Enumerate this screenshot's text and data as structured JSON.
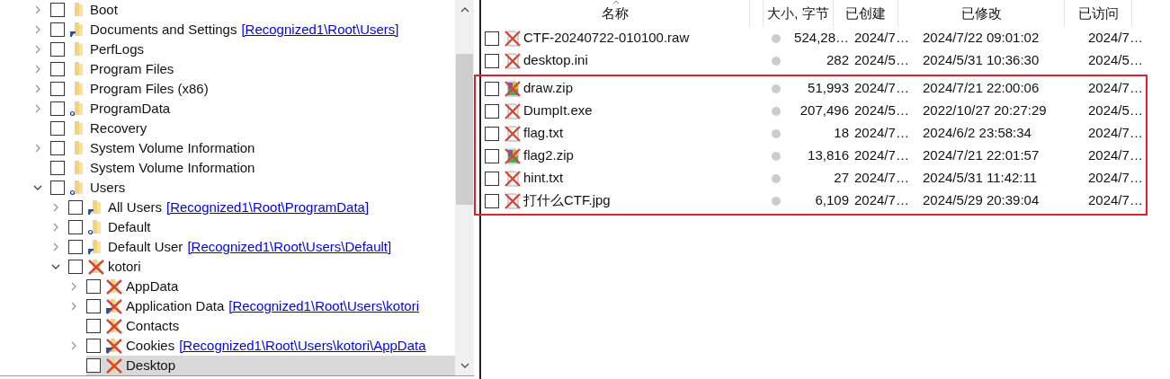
{
  "tree": [
    {
      "label": "Boot",
      "kind": "folder",
      "expanded": false,
      "checked": false,
      "selected": false
    },
    {
      "label": "Documents and Settings",
      "link": "[Recognized1\\Root\\Users]",
      "kind": "link",
      "expanded": false,
      "checked": false,
      "selected": false
    },
    {
      "label": "PerfLogs",
      "kind": "folder",
      "expanded": false,
      "checked": false,
      "selected": false
    },
    {
      "label": "Program Files",
      "kind": "folder",
      "expanded": false,
      "checked": false,
      "selected": false
    },
    {
      "label": "Program Files (x86)",
      "kind": "folder",
      "expanded": false,
      "checked": false,
      "selected": false
    },
    {
      "label": "ProgramData",
      "kind": "system",
      "expanded": false,
      "checked": false,
      "selected": false
    },
    {
      "label": "Recovery",
      "kind": "folder",
      "checked": false,
      "selected": false
    },
    {
      "label": "System Volume Information",
      "kind": "folder",
      "expanded": false,
      "checked": false,
      "selected": false
    },
    {
      "label": "System Volume Information",
      "kind": "folder",
      "checked": false,
      "selected": false
    },
    {
      "label": "Users",
      "kind": "system",
      "expanded": true,
      "checked": false,
      "selected": false,
      "children": [
        {
          "label": "All Users",
          "link": "[Recognized1\\Root\\ProgramData]",
          "kind": "link",
          "expanded": false,
          "checked": false,
          "selected": false
        },
        {
          "label": "Default",
          "kind": "system",
          "expanded": false,
          "checked": false,
          "selected": false
        },
        {
          "label": "Default User",
          "link": "[Recognized1\\Root\\Users\\Default]",
          "kind": "link",
          "expanded": false,
          "checked": false,
          "selected": false
        },
        {
          "label": "kotori",
          "kind": "deleted",
          "expanded": true,
          "checked": false,
          "selected": false,
          "children": [
            {
              "label": "AppData",
              "kind": "deleted",
              "expanded": false,
              "checked": false,
              "selected": false
            },
            {
              "label": "Application Data",
              "link": "[Recognized1\\Root\\Users\\kotori",
              "kind": "deleted-link",
              "expanded": false,
              "checked": false,
              "selected": false
            },
            {
              "label": "Contacts",
              "kind": "deleted",
              "checked": false,
              "selected": false
            },
            {
              "label": "Cookies",
              "link": "[Recognized1\\Root\\Users\\kotori\\AppData",
              "kind": "deleted-link",
              "expanded": false,
              "checked": false,
              "selected": false
            },
            {
              "label": "Desktop",
              "kind": "deleted",
              "checked": false,
              "selected": true
            }
          ]
        }
      ]
    }
  ],
  "table": {
    "columns": [
      "名称",
      "大小, 字节",
      "已创建",
      "已修改",
      "已访问"
    ],
    "rows": [
      {
        "name": "CTF-20240722-010100.raw",
        "kind": "file",
        "size": "524,28…",
        "created": "2024/7…",
        "modified": "2024/7/22 09:01:02",
        "accessed": "2024/7…",
        "checked": false
      },
      {
        "name": "desktop.ini",
        "kind": "file",
        "size": "282",
        "created": "2024/5…",
        "modified": "2024/5/31 10:36:30",
        "accessed": "2024/5…",
        "checked": false
      }
    ],
    "marked_rows": [
      {
        "name": "draw.zip",
        "kind": "archive",
        "size": "51,993",
        "created": "2024/7…",
        "modified": "2024/7/21 22:00:06",
        "accessed": "2024/7…",
        "checked": false
      },
      {
        "name": "DumpIt.exe",
        "kind": "file",
        "size": "207,496",
        "created": "2024/5…",
        "modified": "2022/10/27 20:27:29",
        "accessed": "2024/5…",
        "checked": false
      },
      {
        "name": "flag.txt",
        "kind": "file",
        "size": "18",
        "created": "2024/7…",
        "modified": "2024/6/2 23:58:34",
        "accessed": "2024/7…",
        "checked": false
      },
      {
        "name": "flag2.zip",
        "kind": "archive",
        "size": "13,816",
        "created": "2024/7…",
        "modified": "2024/7/21 22:01:57",
        "accessed": "2024/7…",
        "checked": false
      },
      {
        "name": "hint.txt",
        "kind": "file",
        "size": "27",
        "created": "2024/7…",
        "modified": "2024/5/31 11:42:11",
        "accessed": "2024/7…",
        "checked": false
      },
      {
        "name": "打什么CTF.jpg",
        "kind": "file",
        "size": "6,109",
        "created": "2024/7…",
        "modified": "2024/5/29 20:39:04",
        "accessed": "2024/7…",
        "checked": false
      }
    ]
  }
}
